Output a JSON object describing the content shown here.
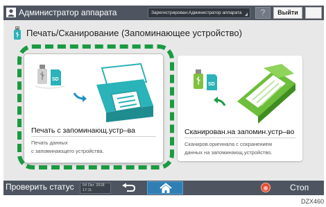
{
  "top_bar": {
    "admin_label": "Администратор аппарата",
    "login_field": "Зарегистрирован:Администратор аппарата",
    "help_label": "?",
    "logout_label": "Выйти"
  },
  "header": {
    "title": "Печать/Сканирование (Запоминающее устройство)"
  },
  "cards": [
    {
      "title": "Печать с запоминающ.устр–ва",
      "desc_line1": "Печать данных",
      "desc_line2": "с запоминающего устройства."
    },
    {
      "title": "Сканирован.на запомин.устр–во",
      "desc_line1": "Сканиров.оригинала с сохранением",
      "desc_line2": "данных на запоминающ.устройство."
    }
  ],
  "bottom_bar": {
    "status_label": "Проверить статус",
    "date": "04 Окт. 2018",
    "time": "17:11",
    "stop_label": "Стоп"
  },
  "watermark": "DZX460",
  "colors": {
    "bar": "#4e5561",
    "accent_green": "#1a9b42",
    "printer_teal": "#2ab3b8",
    "home_blue": "#2f7fb4"
  },
  "icons": [
    "user-icon",
    "help-icon",
    "night-mode-icon",
    "usb-icon",
    "sd-card-icon",
    "printer-icon",
    "scanner-icon",
    "back-icon",
    "home-icon",
    "stop-icon"
  ]
}
